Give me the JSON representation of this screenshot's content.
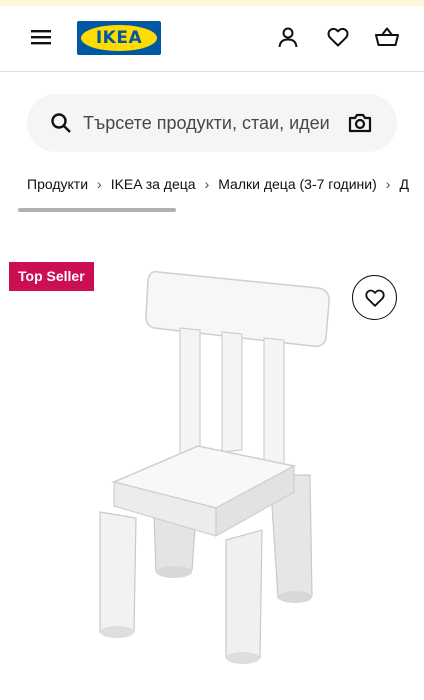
{
  "header": {
    "logo_text": "IKEA",
    "icons": [
      "menu-icon",
      "user-icon",
      "heart-icon",
      "basket-icon"
    ]
  },
  "search": {
    "placeholder": "Търсете продукти, стаи, идеи"
  },
  "breadcrumb": {
    "items": [
      "Продукти",
      "IKEA за деца",
      "Малки деца (3-7 години)",
      "Д"
    ],
    "separator": "›"
  },
  "product": {
    "badge": "Top Seller",
    "favorite_icon": "heart-icon",
    "image": "white-child-chair"
  },
  "colors": {
    "ikea_blue": "#0058a3",
    "ikea_yellow": "#ffdb00",
    "badge_red": "#cc0e53",
    "search_bg": "#f5f5f5"
  }
}
